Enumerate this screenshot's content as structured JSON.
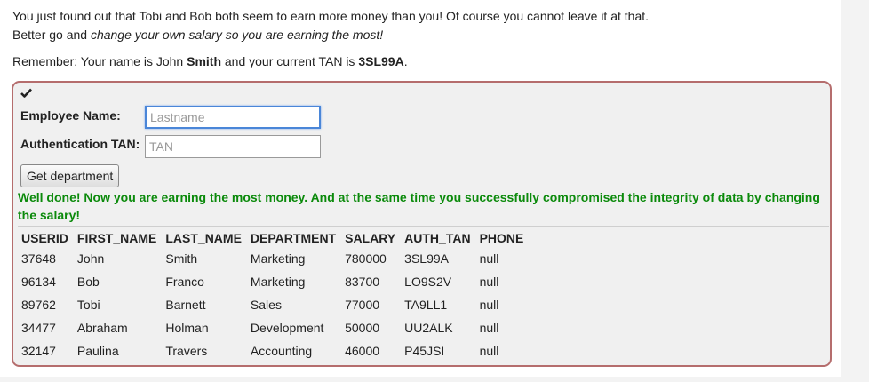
{
  "intro": {
    "line1": "You just found out that Tobi and Bob both seem to earn more money than you! Of course you cannot leave it at that.",
    "line2_prefix": "Better go and ",
    "line2_emph": "change your own salary so you are earning the most!",
    "remember_prefix": "Remember: Your name is John ",
    "remember_name": "Smith",
    "remember_middle": " and your current TAN is ",
    "remember_tan": "3SL99A",
    "remember_suffix": "."
  },
  "form": {
    "check_icon": "checkmark-icon",
    "name_label": "Employee Name:",
    "name_placeholder": "Lastname",
    "name_value": "",
    "tan_label": "Authentication TAN:",
    "tan_placeholder": "TAN",
    "tan_value": "",
    "button_label": "Get department"
  },
  "message": "Well done! Now you are earning the most money. And at the same time you successfully compromised the integrity of data by changing the salary!",
  "table": {
    "headers": [
      "USERID",
      "FIRST_NAME",
      "LAST_NAME",
      "DEPARTMENT",
      "SALARY",
      "AUTH_TAN",
      "PHONE"
    ],
    "rows": [
      [
        "37648",
        "John",
        "Smith",
        "Marketing",
        "780000",
        "3SL99A",
        "null"
      ],
      [
        "96134",
        "Bob",
        "Franco",
        "Marketing",
        "83700",
        "LO9S2V",
        "null"
      ],
      [
        "89762",
        "Tobi",
        "Barnett",
        "Sales",
        "77000",
        "TA9LL1",
        "null"
      ],
      [
        "34477",
        "Abraham",
        "Holman",
        "Development",
        "50000",
        "UU2ALK",
        "null"
      ],
      [
        "32147",
        "Paulina",
        "Travers",
        "Accounting",
        "46000",
        "P45JSI",
        "null"
      ]
    ]
  },
  "colors": {
    "success": "#0b8a0b",
    "box_border": "#b56d6d",
    "focus": "#4a86d8"
  }
}
